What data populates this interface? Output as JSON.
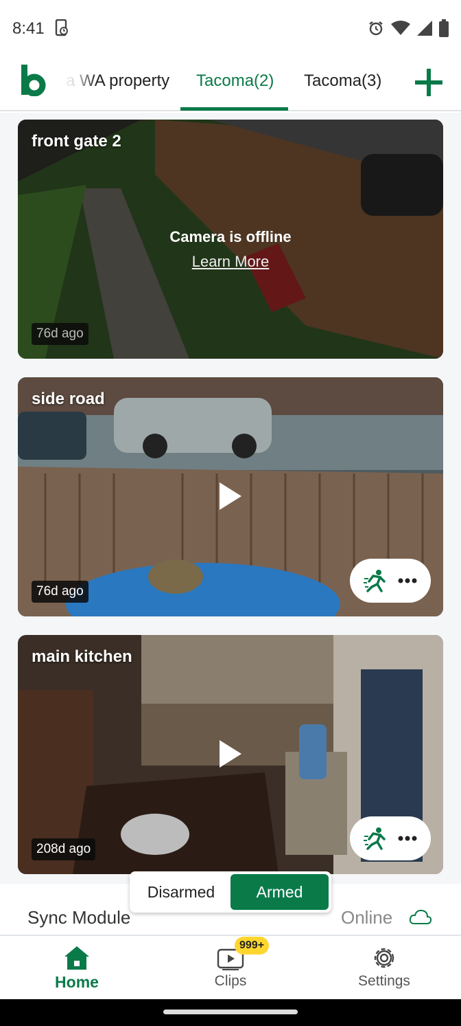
{
  "status_bar": {
    "time": "8:41",
    "icons": [
      "screen-record-icon",
      "alarm-icon",
      "wifi-icon",
      "signal-icon",
      "battery-icon"
    ]
  },
  "header": {
    "logo": "b",
    "tabs": [
      {
        "label": "a WA property",
        "active": false
      },
      {
        "label": "Tacoma(2)",
        "active": true
      },
      {
        "label": "Tacoma(3)",
        "active": false
      }
    ],
    "add_icon": "plus-icon"
  },
  "cameras": [
    {
      "name": "front gate 2",
      "age": "76d ago",
      "offline_title": "Camera is offline",
      "offline_link": "Learn More"
    },
    {
      "name": "side road",
      "age": "76d ago"
    },
    {
      "name": "main kitchen",
      "age": "208d ago"
    }
  ],
  "arm_toggle": {
    "disarmed": "Disarmed",
    "armed": "Armed",
    "selected": "Armed"
  },
  "sync_module": {
    "label": "Sync Module",
    "status": "Online"
  },
  "bottom_nav": {
    "items": [
      {
        "label": "Home",
        "icon": "home-icon",
        "active": true
      },
      {
        "label": "Clips",
        "icon": "clips-icon",
        "active": false,
        "badge": "999+"
      },
      {
        "label": "Settings",
        "icon": "gear-icon",
        "active": false
      }
    ]
  },
  "colors": {
    "brand": "#0a7a49",
    "badge": "#ffd630"
  }
}
